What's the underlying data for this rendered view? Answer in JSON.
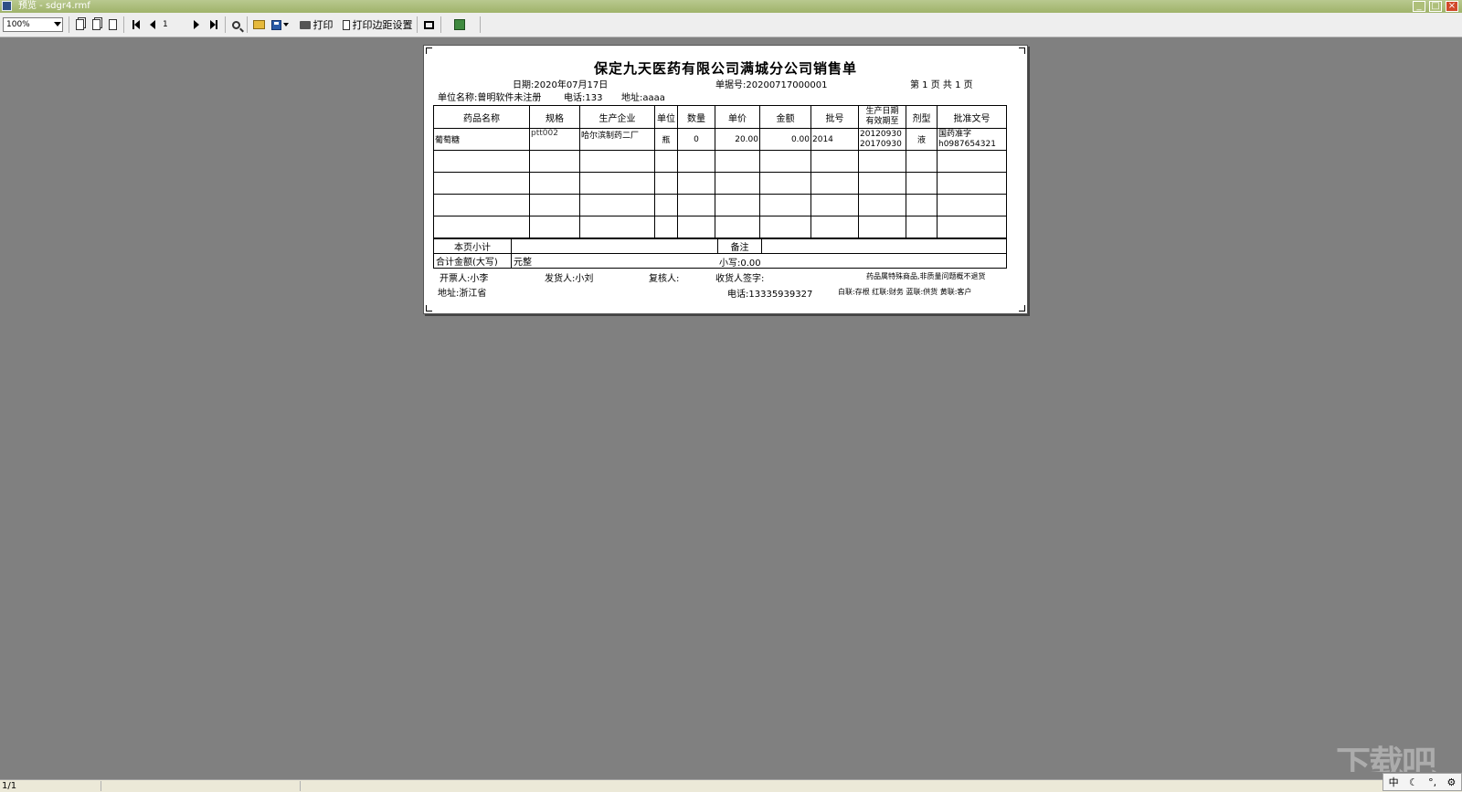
{
  "window": {
    "title": "预览 - sdgr4.rmf"
  },
  "toolbar": {
    "zoom_value": "100%",
    "page_input": "1",
    "print_label": "打印",
    "margin_label": "打印边距设置"
  },
  "document": {
    "title": "保定九天医药有限公司满城分公司销售单",
    "date": "日期:2020年07月17日",
    "bill_no": "单据号:20200717000001",
    "page_info": "第 1 页 共 1 页",
    "unit_name": "单位名称:曾明软件未注册",
    "phone": "电话:133",
    "address": "地址:aaaa",
    "table": {
      "headers": [
        "药品名称",
        "规格",
        "生产企业",
        "单位",
        "数量",
        "单价",
        "金额",
        "批号",
        "生产日期\n有效期至",
        "剂型",
        "批准文号"
      ],
      "header_prod_line1": "生产日期",
      "header_prod_line2": "有效期至",
      "rows": [
        {
          "name": "葡萄糖",
          "spec": "ptt002",
          "maker": "哈尔滨制药二厂",
          "unit": "瓶",
          "qty": "0",
          "price": "20.00",
          "amount": "0.00",
          "batch": "2014",
          "prod_date": "20120930",
          "expiry": "20170930",
          "form": "液",
          "approval_1": "国药准字",
          "approval_2": "h0987654321"
        }
      ]
    },
    "summary": {
      "subtotal_label": "本页小计",
      "remark_label": "备注",
      "total_upper_label": "合计金额(大写)",
      "total_upper_value": "元整",
      "total_lower": "小写:0.00"
    },
    "footer": {
      "issuer": "开票人:小李",
      "shipper": "发货人:小刘",
      "reviewer": "复核人:",
      "receiver": "收货人签字:",
      "note": "药品属特殊商品,非质量问题概不退货",
      "address": "地址:浙江省",
      "phone": "电话:13335939327",
      "copies": "白联:存根  红联:财务  蓝联:供货  黄联:客户"
    }
  },
  "statusbar": {
    "page_count": "1/1"
  },
  "ime": {
    "mode": "中"
  }
}
